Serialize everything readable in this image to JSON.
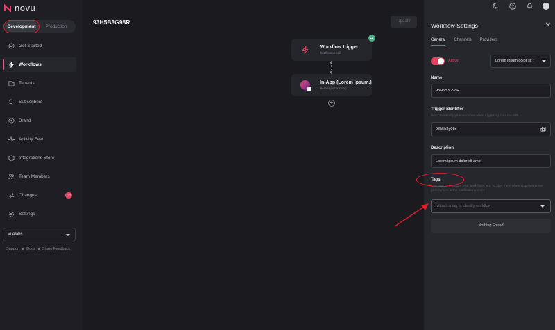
{
  "app": {
    "logo_text": "novu"
  },
  "env": {
    "development": "Development",
    "production": "Production"
  },
  "sidebar": {
    "items": [
      {
        "label": "Get Started",
        "icon": "check-circle-icon"
      },
      {
        "label": "Workflows",
        "icon": "bolt-icon"
      },
      {
        "label": "Tenants",
        "icon": "building-icon"
      },
      {
        "label": "Subscribers",
        "icon": "users-icon"
      },
      {
        "label": "Brand",
        "icon": "palette-icon"
      },
      {
        "label": "Activity Feed",
        "icon": "activity-icon"
      },
      {
        "label": "Integrations Store",
        "icon": "box-icon"
      },
      {
        "label": "Team Members",
        "icon": "team-icon"
      },
      {
        "label": "Changes",
        "icon": "swap-icon",
        "badge": "133"
      },
      {
        "label": "Settings",
        "icon": "gear-icon"
      }
    ],
    "org": "Vuelabs",
    "footer": {
      "support": "Support",
      "docs": "Docs",
      "feedback": "Share Feedback"
    }
  },
  "main": {
    "workflow_title": "93H5B3G98R",
    "update_label": "Update",
    "trigger_node": {
      "title": "Workflow trigger",
      "subtitle": "Notification call"
    },
    "inapp_node": {
      "title": "In-App (Lorem ipsum.)",
      "subtitle": "Here is just a string..."
    }
  },
  "panel": {
    "title": "Workflow Settings",
    "tabs": [
      "General",
      "Channels",
      "Providers"
    ],
    "active_label": "Active",
    "group_select": "Lorem ipsum dolor sit :",
    "name_label": "Name",
    "name_value": "93H5B3G98R",
    "trigger_label": "Trigger identifier",
    "trigger_help": "Used to identify your workflow when triggering it via the API",
    "trigger_value": "93h5b3g98r",
    "description_label": "Description",
    "description_value": "Lorem ipsum dolor sit ame.",
    "tags_label": "Tags",
    "tags_help": "Use tags to organize your workflows, e.g. to filter them when displaying user preferences in the notification center",
    "tags_placeholder": "Attach a tag to identify workflow",
    "nothing_found": "Nothing Found"
  },
  "colors": {
    "accent": "#e8415f",
    "annotation": "#e21c2a",
    "success": "#4caf8a"
  }
}
